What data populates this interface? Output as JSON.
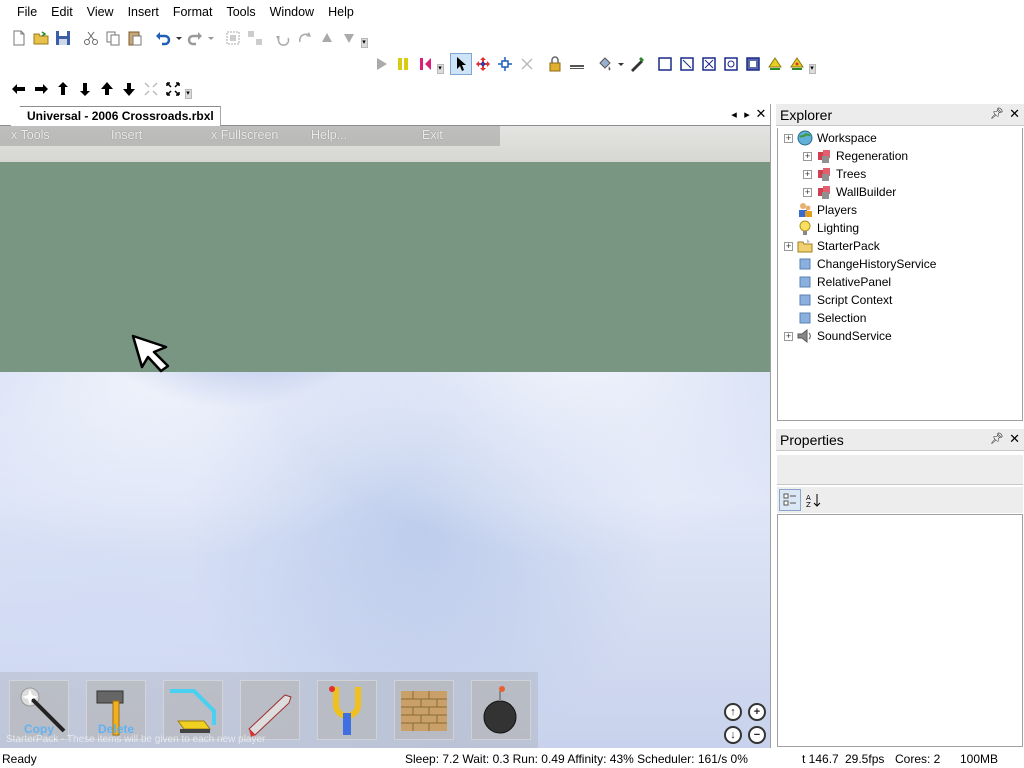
{
  "menu": [
    "File",
    "Edit",
    "View",
    "Insert",
    "Format",
    "Tools",
    "Window",
    "Help"
  ],
  "document": {
    "tab_title": "Universal - 2006 Crossroads.rbxl"
  },
  "game_gui": {
    "top_buttons": [
      "x Tools",
      "Insert",
      "x Fullscreen",
      "Help...",
      "Exit"
    ],
    "tools": [
      {
        "label": "Copy",
        "icon": "wand-icon"
      },
      {
        "label": "Delete",
        "icon": "hammer-icon"
      },
      {
        "label": "",
        "icon": "resize-tool-icon"
      },
      {
        "label": "",
        "icon": "rocket-icon"
      },
      {
        "label": "",
        "icon": "slingshot-icon"
      },
      {
        "label": "",
        "icon": "brick-wall-icon"
      },
      {
        "label": "",
        "icon": "bomb-icon"
      }
    ],
    "hint": "StarterPack - These items will be given to each new player"
  },
  "explorer": {
    "title": "Explorer",
    "items": [
      {
        "label": "Workspace",
        "icon": "workspace-icon",
        "level": 0,
        "expandable": true
      },
      {
        "label": "Regeneration",
        "icon": "model-icon",
        "level": 1,
        "expandable": true
      },
      {
        "label": "Trees",
        "icon": "model-icon",
        "level": 1,
        "expandable": true
      },
      {
        "label": "WallBuilder",
        "icon": "model-icon",
        "level": 1,
        "expandable": true
      },
      {
        "label": "Players",
        "icon": "players-icon",
        "level": 0,
        "expandable": false
      },
      {
        "label": "Lighting",
        "icon": "lightbulb-icon",
        "level": 0,
        "expandable": false
      },
      {
        "label": "StarterPack",
        "icon": "folder-icon",
        "level": 0,
        "expandable": true
      },
      {
        "label": "ChangeHistoryService",
        "icon": "service-icon",
        "level": 0,
        "expandable": false
      },
      {
        "label": "RelativePanel",
        "icon": "service-icon",
        "level": 0,
        "expandable": false
      },
      {
        "label": "Script Context",
        "icon": "service-icon",
        "level": 0,
        "expandable": false
      },
      {
        "label": "Selection",
        "icon": "service-icon",
        "level": 0,
        "expandable": false
      },
      {
        "label": "SoundService",
        "icon": "speaker-icon",
        "level": 0,
        "expandable": true
      }
    ]
  },
  "properties": {
    "title": "Properties"
  },
  "status": {
    "ready": "Ready",
    "perf": "Sleep: 7.2 Wait: 0.3 Run: 0.49 Affinity: 43% Scheduler: 161/s 0%",
    "time": "t 146.7",
    "fps": "29.5fps",
    "cores": "Cores: 2",
    "memory": "100MB"
  },
  "colors": {
    "baseplate": "#789682",
    "select_highlight": "#cfe3f7",
    "tool_label": "#4db0ff"
  }
}
